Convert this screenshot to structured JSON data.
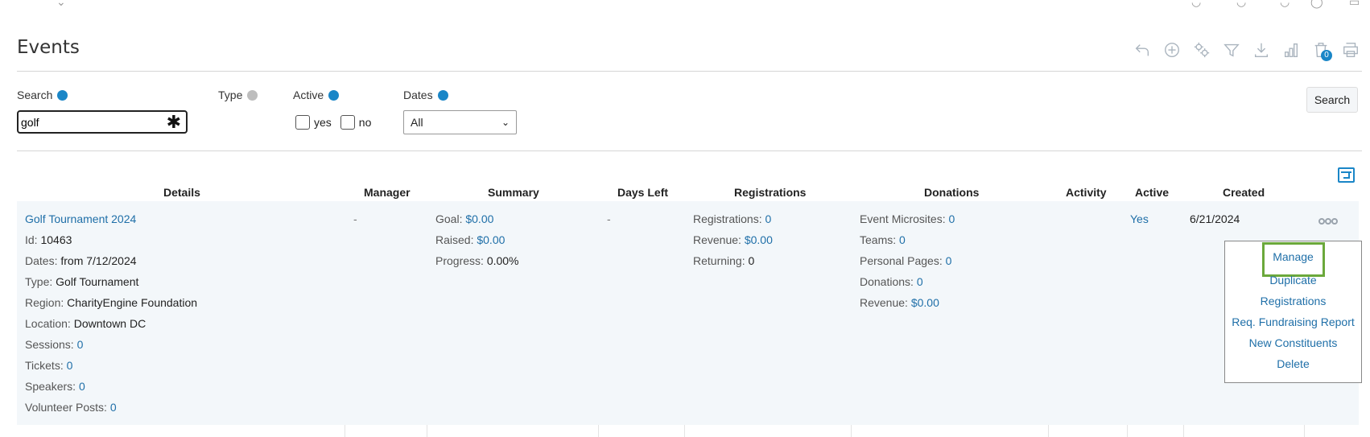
{
  "page": {
    "title": "Events"
  },
  "toolbar": {
    "icons": [
      "back-icon",
      "add-icon",
      "settings-icon",
      "filter-icon",
      "download-icon",
      "chart-icon",
      "delete-icon",
      "print-icon"
    ],
    "delete_badge": "0"
  },
  "filters": {
    "search_label": "Search",
    "search_value": "golf",
    "clear_glyph": "✱",
    "type_label": "Type",
    "active_label": "Active",
    "active_yes": "yes",
    "active_no": "no",
    "dates_label": "Dates",
    "dates_value": "All",
    "search_button": "Search"
  },
  "table": {
    "headers": [
      "Details",
      "Manager",
      "Summary",
      "Days Left",
      "Registrations",
      "Donations",
      "Activity",
      "Active",
      "Created"
    ],
    "row": {
      "name": "Golf Tournament 2024",
      "details": [
        {
          "k": "Id:",
          "v": "10463"
        },
        {
          "k": "Dates:",
          "v": "from 7/12/2024"
        },
        {
          "k": "Type:",
          "v": "Golf Tournament"
        },
        {
          "k": "Region:",
          "v": "CharityEngine Foundation"
        },
        {
          "k": "Location:",
          "v": "Downtown DC"
        },
        {
          "k": "Sessions:",
          "v": "0"
        },
        {
          "k": "Tickets:",
          "v": "0"
        },
        {
          "k": "Speakers:",
          "v": "0"
        },
        {
          "k": "Volunteer Posts:",
          "v": "0"
        }
      ],
      "manager": "-",
      "summary": [
        {
          "k": "Goal:",
          "v": "$0.00"
        },
        {
          "k": "Raised:",
          "v": "$0.00"
        },
        {
          "k": "Progress:",
          "v": "0.00%"
        }
      ],
      "days_left": "-",
      "registrations": [
        {
          "k": "Registrations:",
          "v": "0"
        },
        {
          "k": "Revenue:",
          "v": "$0.00"
        },
        {
          "k": "Returning:",
          "v": "0"
        }
      ],
      "donations": [
        {
          "k": "Event Microsites:",
          "v": "0"
        },
        {
          "k": "Teams:",
          "v": "0"
        },
        {
          "k": "Personal Pages:",
          "v": "0"
        },
        {
          "k": "Donations:",
          "v": "0"
        },
        {
          "k": "Revenue:",
          "v": "$0.00"
        }
      ],
      "active": "Yes",
      "created": "6/21/2024"
    }
  },
  "row_menu": {
    "items": [
      "Manage",
      "Duplicate",
      "Registrations",
      "Req. Fundraising Report",
      "New Constituents",
      "Delete"
    ],
    "highlight_color": "#6ba83b"
  },
  "colors": {
    "accent": "#1a86c7",
    "link": "#1f6fa8",
    "row_bg": "#f3f7fa"
  }
}
